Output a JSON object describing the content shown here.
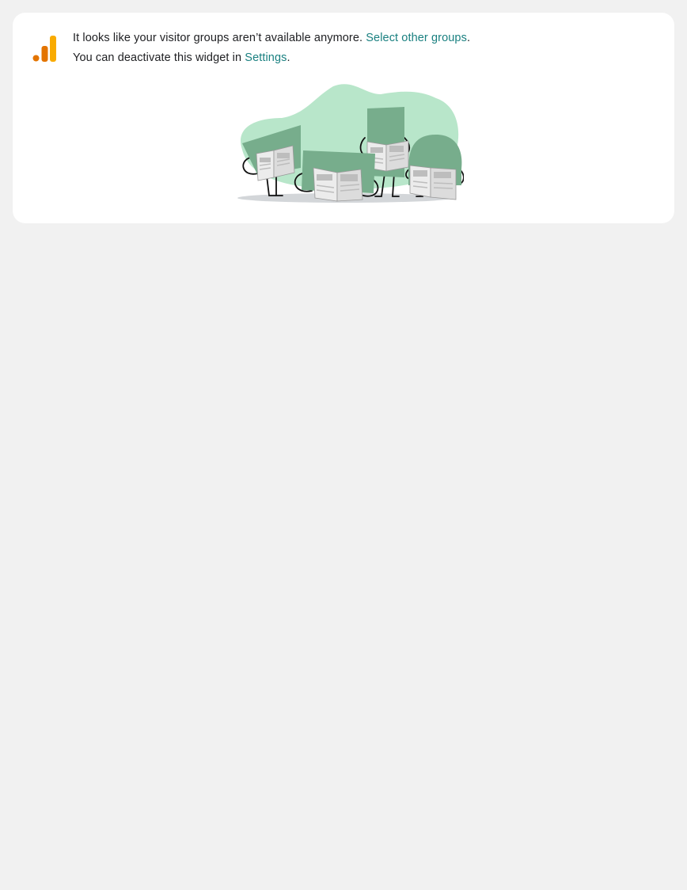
{
  "widget": {
    "line1_text": "It looks like your visitor groups aren’t available anymore. ",
    "line1_link": "Select other groups",
    "line1_end": ".",
    "line2_text": "You can deactivate this widget in ",
    "line2_link": "Settings",
    "line2_end": "."
  },
  "colors": {
    "link": "#1a8080",
    "logo_dark": "#e37400",
    "logo_light": "#f9ab00",
    "blob": "#b8e6ca",
    "character": "#77ad8c"
  },
  "icons": {
    "logo": "analytics-bars-icon"
  }
}
